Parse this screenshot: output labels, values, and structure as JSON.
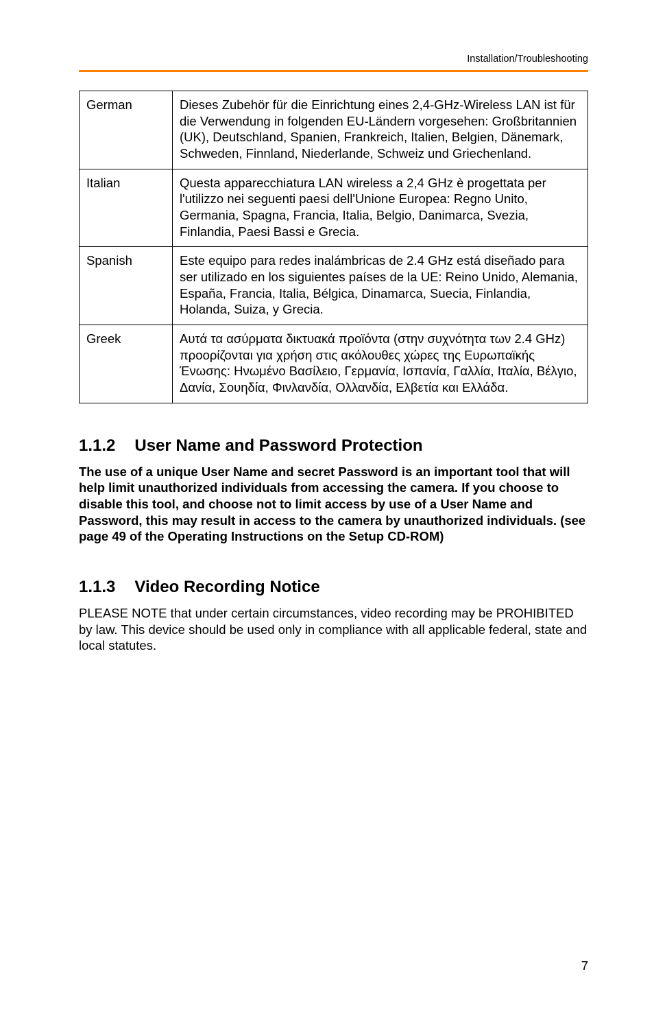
{
  "running_head": "Installation/Troubleshooting",
  "table": {
    "rows": [
      {
        "lang": "German",
        "text": "Dieses Zubehör für die Einrichtung eines 2,4-GHz-Wireless LAN ist für die Verwendung in folgenden EU-Ländern vorgesehen: Großbritannien (UK), Deutschland, Spanien, Frankreich, Italien, Belgien, Dänemark, Schweden, Finnland, Niederlande, Schweiz und Griechenland."
      },
      {
        "lang": "Italian",
        "text": "Questa apparecchiatura LAN wireless a 2,4 GHz è progettata per l'utilizzo nei seguenti paesi dell'Unione Europea: Regno Unito, Germania, Spagna, Francia, Italia, Belgio, Danimarca, Svezia, Finlandia, Paesi Bassi e Grecia."
      },
      {
        "lang": "Spanish",
        "text": "Este equipo para redes inalámbricas de 2.4 GHz está diseñado para ser utilizado en los siguientes países de la UE: Reino Unido, Alemania, España, Francia, Italia, Bélgica, Dinamarca, Suecia, Finlandia, Holanda, Suiza, y Grecia."
      },
      {
        "lang": "Greek",
        "text": "Αυτά τα ασύρματα δικτυακά προϊόντα (στην συχνότητα των 2.4 GHz) προορίζονται για χρήση στις ακόλουθες χώρες της Ευρωπαϊκής Ένωσης: Ηνωμένο Βασίλειο, Γερμανία, Ισπανία, Γαλλία, Ιταλία, Βέλγιο, Δανία, Σουηδία, Φινλανδία, Ολλανδία, Ελβετία και Ελλάδα."
      }
    ]
  },
  "section112": {
    "number": "1.1.2",
    "title": "User Name and Password Protection",
    "body": "The use of a unique User Name and secret Password is an important tool that will help limit unauthorized individuals from accessing the camera. If you choose to disable this tool, and choose not to limit access by use of a User Name and Password, this may result in access to the camera by unauthorized individuals. (see page 49 of the Operating Instructions on the Setup CD-ROM)"
  },
  "section113": {
    "number": "1.1.3",
    "title": "Video Recording Notice",
    "body": "PLEASE NOTE that under certain circumstances, video recording may be PROHIBITED by law. This device should be used only in compliance with all applicable federal, state and local statutes."
  },
  "page_number": "7"
}
